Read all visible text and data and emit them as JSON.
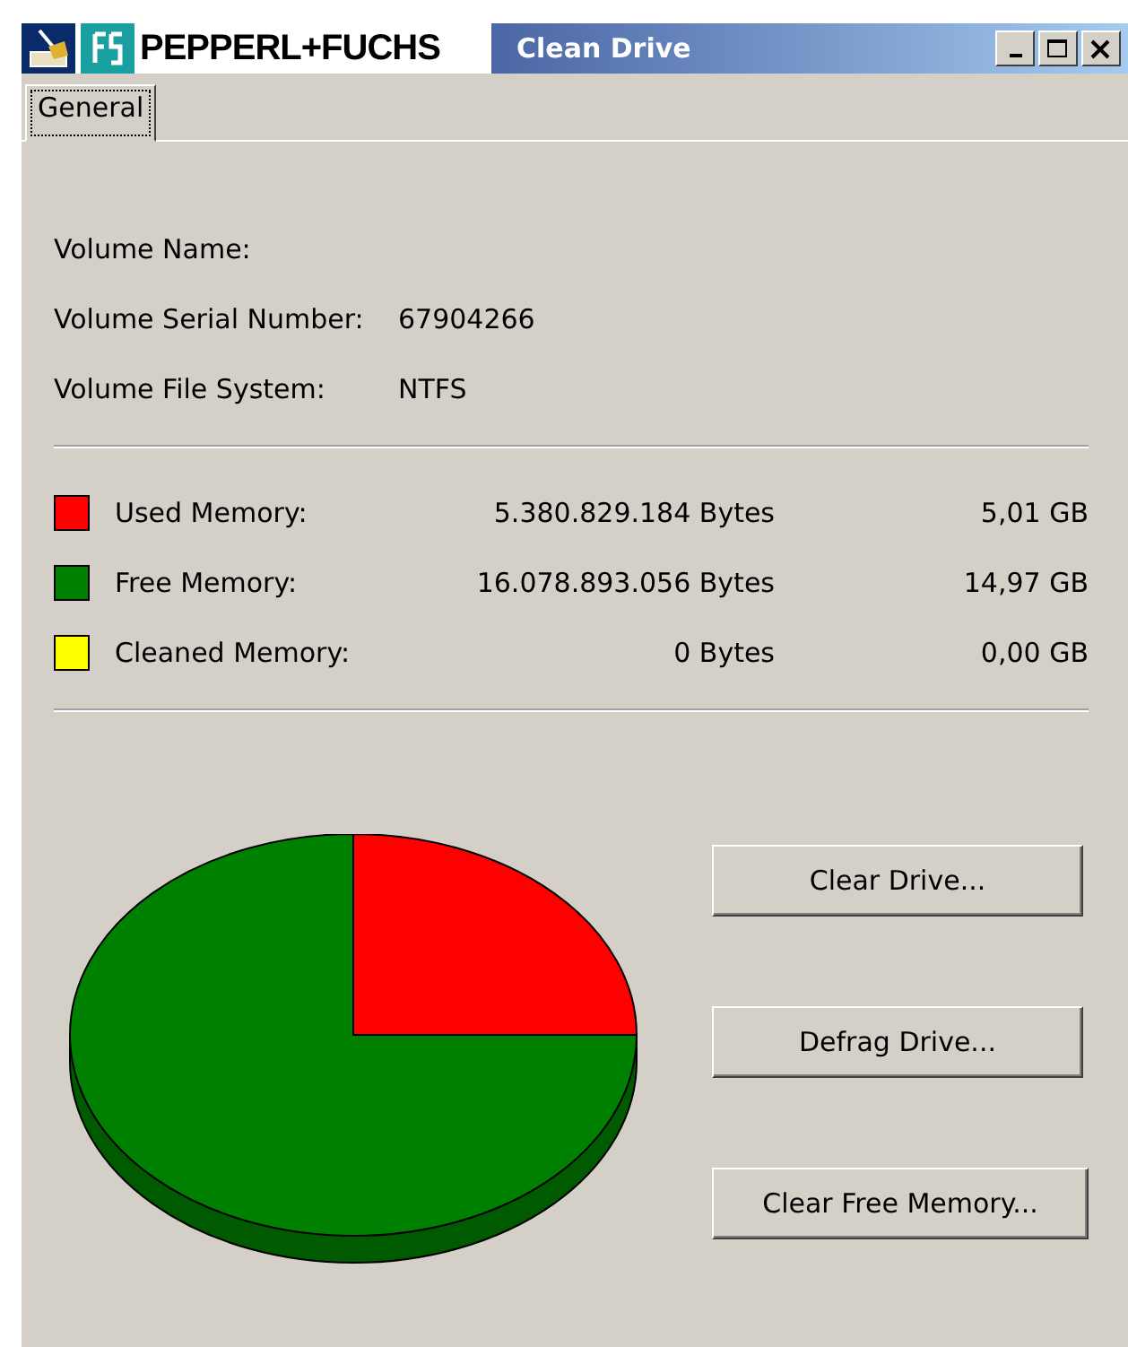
{
  "window": {
    "logo_text": "PEPPERL+FUCHS",
    "title": "Clean Drive"
  },
  "tabs": [
    {
      "label": "General",
      "selected": true
    }
  ],
  "volume_info": [
    {
      "label": "Volume Name:"
    },
    {
      "label": "Volume Serial Number:",
      "value": "67904266"
    },
    {
      "label": "Volume File System:",
      "value": "NTFS"
    }
  ],
  "memory": [
    {
      "label": "Used Memory:",
      "bytes": "5.380.829.184 Bytes",
      "size": "5,01 GB",
      "color": "#ff0000"
    },
    {
      "label": "Free Memory:",
      "bytes": "16.078.893.056 Bytes",
      "size": "14,97 GB",
      "color": "#008000"
    },
    {
      "label": "Cleaned Memory:",
      "bytes": "0 Bytes",
      "size": "0,00 GB",
      "color": "#ffff00"
    }
  ],
  "buttons": [
    "Clear Drive...",
    "Defrag Drive...",
    "Clear Free Memory..."
  ]
}
